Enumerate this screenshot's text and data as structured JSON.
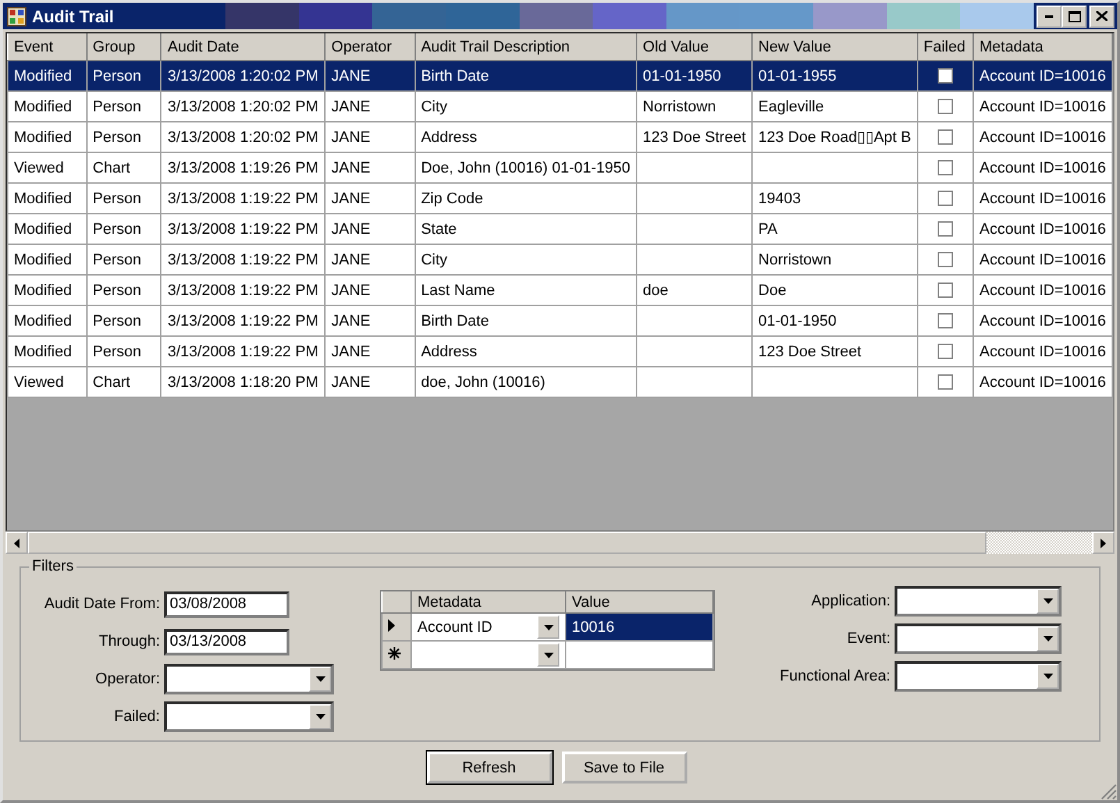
{
  "window": {
    "title": "Audit Trail"
  },
  "table": {
    "columns": [
      "Event",
      "Group",
      "Audit Date",
      "Operator",
      "Audit Trail Description",
      "Old Value",
      "New Value",
      "Failed",
      "Metadata"
    ],
    "rows": [
      {
        "selected": true,
        "cells": [
          "Modified",
          "Person",
          "3/13/2008 1:20:02 PM",
          "JANE",
          "Birth Date",
          "01-01-1950",
          "01-01-1955"
        ],
        "failed": false,
        "metadata": "Account ID=10016"
      },
      {
        "selected": false,
        "cells": [
          "Modified",
          "Person",
          "3/13/2008 1:20:02 PM",
          "JANE",
          "City",
          "Norristown",
          "Eagleville"
        ],
        "failed": false,
        "metadata": "Account ID=10016"
      },
      {
        "selected": false,
        "cells": [
          "Modified",
          "Person",
          "3/13/2008 1:20:02 PM",
          "JANE",
          "Address",
          "123 Doe Street",
          "123 Doe Road▯▯Apt B"
        ],
        "failed": false,
        "metadata": "Account ID=10016"
      },
      {
        "selected": false,
        "cells": [
          "Viewed",
          "Chart",
          "3/13/2008 1:19:26 PM",
          "JANE",
          "Doe, John (10016) 01-01-1950",
          "",
          ""
        ],
        "failed": false,
        "metadata": "Account ID=10016"
      },
      {
        "selected": false,
        "cells": [
          "Modified",
          "Person",
          "3/13/2008 1:19:22 PM",
          "JANE",
          "Zip Code",
          "",
          "19403"
        ],
        "failed": false,
        "metadata": "Account ID=10016"
      },
      {
        "selected": false,
        "cells": [
          "Modified",
          "Person",
          "3/13/2008 1:19:22 PM",
          "JANE",
          "State",
          "",
          "PA"
        ],
        "failed": false,
        "metadata": "Account ID=10016"
      },
      {
        "selected": false,
        "cells": [
          "Modified",
          "Person",
          "3/13/2008 1:19:22 PM",
          "JANE",
          "City",
          "",
          "Norristown"
        ],
        "failed": false,
        "metadata": "Account ID=10016"
      },
      {
        "selected": false,
        "cells": [
          "Modified",
          "Person",
          "3/13/2008 1:19:22 PM",
          "JANE",
          "Last Name",
          "doe",
          "Doe"
        ],
        "failed": false,
        "metadata": "Account ID=10016"
      },
      {
        "selected": false,
        "cells": [
          "Modified",
          "Person",
          "3/13/2008 1:19:22 PM",
          "JANE",
          "Birth Date",
          "",
          "01-01-1950"
        ],
        "failed": false,
        "metadata": "Account ID=10016"
      },
      {
        "selected": false,
        "cells": [
          "Modified",
          "Person",
          "3/13/2008 1:19:22 PM",
          "JANE",
          "Address",
          "",
          "123 Doe Street"
        ],
        "failed": false,
        "metadata": "Account ID=10016"
      },
      {
        "selected": false,
        "cells": [
          "Viewed",
          "Chart",
          "3/13/2008 1:18:20 PM",
          "JANE",
          "doe, John (10016)",
          "",
          ""
        ],
        "failed": false,
        "metadata": "Account ID=10016"
      }
    ]
  },
  "filters": {
    "title": "Filters",
    "left": [
      {
        "label": "Audit Date From:",
        "kind": "text",
        "value": "03/08/2008"
      },
      {
        "label": "Through:",
        "kind": "text",
        "value": "03/13/2008"
      },
      {
        "label": "Operator:",
        "kind": "combo"
      },
      {
        "label": "Failed:",
        "kind": "combo"
      }
    ],
    "metadata_grid": {
      "columns": [
        "Metadata",
        "Value"
      ],
      "rows": [
        {
          "current": true,
          "new_row": false,
          "metadata": "Account ID",
          "value": "10016",
          "selected": true
        },
        {
          "current": false,
          "new_row": true,
          "selected": false
        }
      ]
    },
    "right": [
      {
        "label": "Application:",
        "kind": "combo"
      },
      {
        "label": "Event:",
        "kind": "combo"
      },
      {
        "label": "Functional Area:",
        "kind": "combo"
      }
    ]
  },
  "buttons": [
    {
      "label": "Refresh",
      "default": true
    },
    {
      "label": "Save to File",
      "default": false
    }
  ]
}
